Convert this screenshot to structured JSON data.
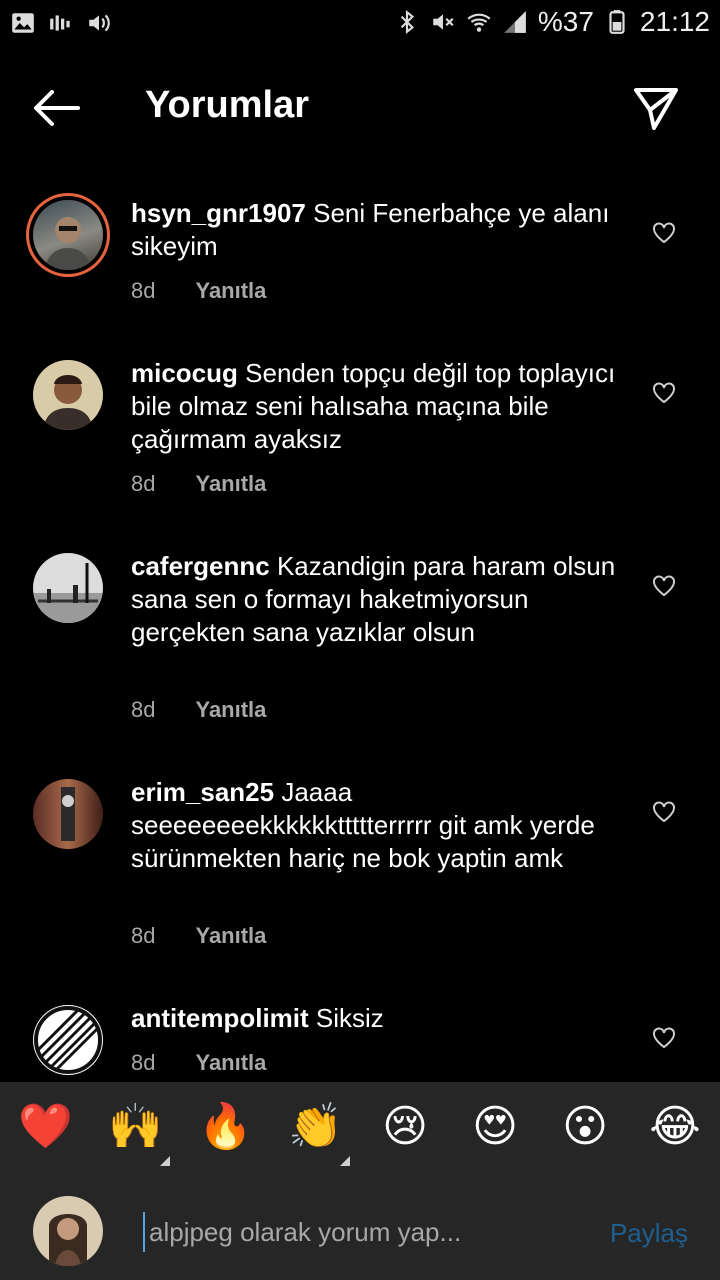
{
  "status_bar": {
    "battery": "%37",
    "time": "21:12"
  },
  "header": {
    "title": "Yorumlar"
  },
  "comments": [
    {
      "username": "hsyn_gnr1907",
      "text": "Seni Fenerbahçe ye alanı sikeyim",
      "age": "8d",
      "reply": "Yanıtla"
    },
    {
      "username": "micocug",
      "text": "Senden topçu değil top toplayıcı bile olmaz seni halısaha maçına bile çağırmam ayaksız",
      "age": "8d",
      "reply": "Yanıtla"
    },
    {
      "username": "cafergennc",
      "text": "Kazandigin para haram olsun sana sen o formayı haketmiyorsun gerçekten sana yazıklar olsun",
      "age": "8d",
      "reply": "Yanıtla"
    },
    {
      "username": "erim_san25",
      "text": "Jaaaa seeeeeeeekkkkkkttttterrrrr git amk yerde sürünmekten hariç ne bok yaptin amk",
      "age": "8d",
      "reply": "Yanıtla"
    },
    {
      "username": "antitempolimit",
      "text": "Siksiz",
      "age": "8d",
      "reply": "Yanıtla"
    }
  ],
  "emoji_bar": [
    "❤️",
    "🙌",
    "🔥",
    "👏",
    "😢",
    "😍",
    "😮",
    "😂"
  ],
  "composer": {
    "placeholder": "alpjpeg olarak yorum yap...",
    "share_label": "Paylaş"
  },
  "colors": {
    "background": "#000000",
    "bar": "#262626",
    "muted": "#a8a8a8",
    "share": "#1f5f8f"
  }
}
